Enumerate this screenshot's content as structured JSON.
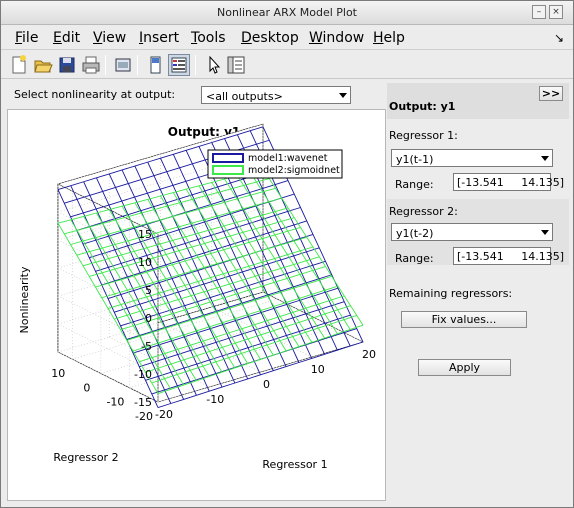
{
  "window": {
    "title": "Nonlinear ARX Model Plot"
  },
  "menubar": {
    "items": [
      {
        "label": "File",
        "key": "F",
        "rest": "ile"
      },
      {
        "label": "Edit",
        "key": "E",
        "rest": "dit"
      },
      {
        "label": "View",
        "key": "V",
        "rest": "iew"
      },
      {
        "label": "Insert",
        "key": "I",
        "rest": "nsert"
      },
      {
        "label": "Tools",
        "key": "T",
        "rest": "ools"
      },
      {
        "label": "Desktop",
        "key": "D",
        "rest": "esktop"
      },
      {
        "label": "Window",
        "key": "W",
        "rest": "indow"
      },
      {
        "label": "Help",
        "key": "H",
        "rest": "elp"
      }
    ],
    "dock_icon": "↘"
  },
  "toolbar": {
    "icons": [
      "new-figure-icon",
      "open-icon",
      "save-icon",
      "print-icon",
      "print-preview-icon",
      "hide-panel-icon",
      "show-panel-icon",
      "pointer-icon",
      "property-editor-icon"
    ]
  },
  "selector": {
    "label": "Select nonlinearity at output:",
    "value": "<all outputs>"
  },
  "plot": {
    "title": "Output: y1",
    "zlabel": "Nonlinearity",
    "xlabel": "Regressor 1",
    "ylabel": "Regressor 2",
    "ztick_labels": [
      "15",
      "10",
      "5",
      "0",
      "-5",
      "-10",
      "-15"
    ],
    "xtick_labels": [
      "-20",
      "-10",
      "0",
      "10",
      "20"
    ],
    "ytick_labels": [
      "10",
      "0",
      "-10",
      "-20"
    ],
    "legend": [
      {
        "label": "model1:wavenet",
        "color": "#1a1aa0"
      },
      {
        "label": "model2:sigmoidnet",
        "color": "#3ee84a"
      }
    ]
  },
  "chart_data": {
    "type": "surface",
    "title": "Output: y1",
    "xlabel": "Regressor 1",
    "ylabel": "Regressor 2",
    "zlabel": "Nonlinearity",
    "xlim": [
      -20,
      20
    ],
    "ylim": [
      -20,
      15
    ],
    "zlim": [
      -15,
      15
    ],
    "grid": true,
    "legend_position": "top-right",
    "series": [
      {
        "name": "model1:wavenet",
        "color": "#1a1aa0",
        "corner_values": {
          "x_min_y_min": -16,
          "x_max_y_min": -15,
          "x_min_y_max": 14,
          "x_max_y_max": 14.5
        }
      },
      {
        "name": "model2:sigmoidnet",
        "color": "#3ee84a",
        "corner_values": {
          "x_min_y_min": -13.5,
          "x_max_y_min": -12,
          "x_min_y_max": 8,
          "x_max_y_max": 7
        }
      }
    ]
  },
  "right_panel": {
    "expand_label": ">>",
    "output_label": "Output: y1",
    "regressor1": {
      "label": "Regressor 1:",
      "value": "y1(t-1)",
      "range_label": "Range:",
      "range": "[-13.541     14.135]"
    },
    "regressor2": {
      "label": "Regressor 2:",
      "value": "y1(t-2)",
      "range_label": "Range:",
      "range": "[-13.541     14.135]"
    },
    "remaining_label": "Remaining regressors:",
    "fix_values_label": "Fix values...",
    "apply_label": "Apply"
  }
}
